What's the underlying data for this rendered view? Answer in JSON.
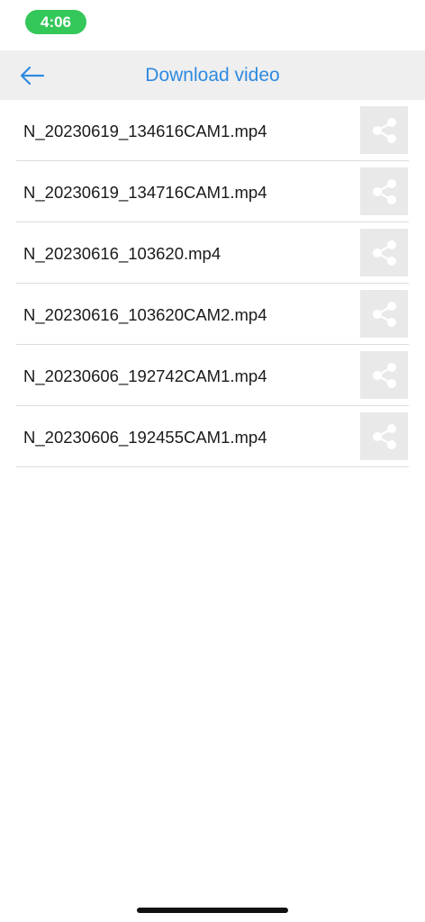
{
  "status_bar": {
    "time": "4:06",
    "pill_color": "#34c759"
  },
  "header": {
    "title": "Download video",
    "back_icon": "arrow-left-icon",
    "accent_color": "#2f8ae0"
  },
  "files": [
    {
      "name": "N_20230619_134616CAM1.mp4",
      "action_icon": "share-icon"
    },
    {
      "name": "N_20230619_134716CAM1.mp4",
      "action_icon": "share-icon"
    },
    {
      "name": "N_20230616_103620.mp4",
      "action_icon": "share-icon"
    },
    {
      "name": "N_20230616_103620CAM2.mp4",
      "action_icon": "share-icon"
    },
    {
      "name": "N_20230606_192742CAM1.mp4",
      "action_icon": "share-icon"
    },
    {
      "name": "N_20230606_192455CAM1.mp4",
      "action_icon": "share-icon"
    }
  ]
}
